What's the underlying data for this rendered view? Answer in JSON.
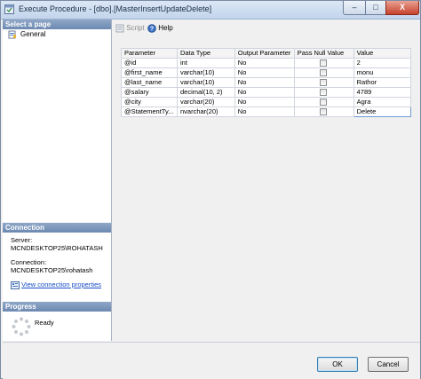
{
  "window": {
    "title": "Execute Procedure - [dbo].[MasterInsertUpdateDelete]",
    "min_glyph": "–",
    "max_glyph": "□",
    "close_glyph": "X"
  },
  "left_pane": {
    "select_page_header": "Select a page",
    "pages": [
      {
        "label": "General",
        "icon": "general-page-icon"
      }
    ],
    "connection_header": "Connection",
    "server_label": "Server:",
    "server_value": "MCNDESKTOP25\\ROHATASH",
    "connection_label": "Connection:",
    "connection_value": "MCNDESKTOP25\\rohatash",
    "view_connection_link": "View connection properties",
    "progress_header": "Progress",
    "progress_status": "Ready"
  },
  "toolbar": {
    "script_label": "Script",
    "help_label": "Help"
  },
  "grid": {
    "columns": [
      "Parameter",
      "Data Type",
      "Output Parameter",
      "Pass Null Value",
      "Value"
    ],
    "rows": [
      {
        "parameter": "@id",
        "data_type": "int",
        "output": "No",
        "pass_null": false,
        "value": "2"
      },
      {
        "parameter": "@first_name",
        "data_type": "varchar(10)",
        "output": "No",
        "pass_null": false,
        "value": "monu"
      },
      {
        "parameter": "@last_name",
        "data_type": "varchar(10)",
        "output": "No",
        "pass_null": false,
        "value": "Rathor"
      },
      {
        "parameter": "@salary",
        "data_type": "decimal(10, 2)",
        "output": "No",
        "pass_null": false,
        "value": "4789"
      },
      {
        "parameter": "@city",
        "data_type": "varchar(20)",
        "output": "No",
        "pass_null": false,
        "value": "Agra"
      },
      {
        "parameter": "@StatementTy...",
        "data_type": "nvarchar(20)",
        "output": "No",
        "pass_null": false,
        "value": "Delete"
      }
    ]
  },
  "footer": {
    "ok_label": "OK",
    "cancel_label": "Cancel"
  },
  "colors": {
    "link": "#1a4fc6",
    "section_header": "#6d89b1",
    "close_button": "#c6422b"
  }
}
